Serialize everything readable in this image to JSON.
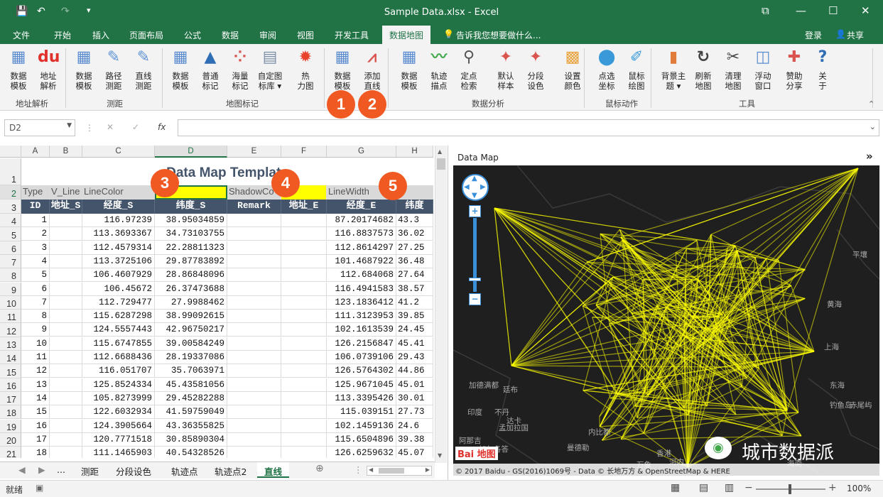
{
  "window": {
    "title": "Sample Data.xlsx - Excel",
    "save_icon": "💾",
    "undo_icon": "↶",
    "redo_icon": "↷",
    "qa_more": "▾",
    "ribbon_display": "⧉",
    "minimize": "—",
    "maximize": "☐",
    "close": "✕"
  },
  "tabs": [
    "文件",
    "开始",
    "插入",
    "页面布局",
    "公式",
    "数据",
    "审阅",
    "视图",
    "开发工具",
    "数据地图"
  ],
  "tell_me": "告诉我您想要做什么...",
  "login": "登录",
  "share": "共享",
  "ribbon": {
    "buttons": [
      {
        "l1": "数据",
        "l2": "模板",
        "icon": "grid-icon",
        "color": "#5a8ccf"
      },
      {
        "l1": "地址",
        "l2": "解析",
        "icon": "du-pin-icon",
        "color": "#e0312b"
      },
      {
        "l1": "数据",
        "l2": "模板",
        "icon": "grid-icon",
        "color": "#5a8ccf"
      },
      {
        "l1": "路径",
        "l2": "测距",
        "icon": "pencil-ruler-icon",
        "color": "#5e93d6"
      },
      {
        "l1": "直线",
        "l2": "测距",
        "icon": "pencil-line-icon",
        "color": "#5e93d6"
      },
      {
        "l1": "数据",
        "l2": "模板",
        "icon": "grid-icon",
        "color": "#5a8ccf"
      },
      {
        "l1": "普通",
        "l2": "标记",
        "icon": "pyramid-icon",
        "color": "#2f6db5"
      },
      {
        "l1": "海量",
        "l2": "标记",
        "icon": "scatter-icon",
        "color": "#d9534f"
      },
      {
        "l1": "自定图",
        "l2": "标库 ▾",
        "icon": "image-library-icon",
        "color": "#7a8fa6"
      },
      {
        "l1": "热",
        "l2": "力图",
        "icon": "heatmap-icon",
        "color": "#e8412c"
      },
      {
        "l1": "数据",
        "l2": "模板",
        "icon": "grid-icon",
        "color": "#5a8ccf"
      },
      {
        "l1": "添加",
        "l2": "直线",
        "icon": "line-chart-icon",
        "color": "#d9534f"
      },
      {
        "l1": "数据",
        "l2": "模板",
        "icon": "grid-icon",
        "color": "#5a8ccf"
      },
      {
        "l1": "轨迹",
        "l2": "描点",
        "icon": "track-icon",
        "color": "#3fa64a"
      },
      {
        "l1": "定点",
        "l2": "检索",
        "icon": "binoculars-icon",
        "color": "#555"
      },
      {
        "l1": "默认",
        "l2": "样本",
        "icon": "china-map-icon",
        "color": "#d9534f"
      },
      {
        "l1": "分段",
        "l2": "设色",
        "icon": "china-map-icon",
        "color": "#d9534f"
      },
      {
        "l1": "设置",
        "l2": "颜色",
        "icon": "palette-icon",
        "color": "#e8a33c"
      },
      {
        "l1": "点选",
        "l2": "坐标",
        "icon": "pin-icon",
        "color": "#3a9ad9"
      },
      {
        "l1": "鼠标",
        "l2": "绘图",
        "icon": "map-draw-icon",
        "color": "#3a9ad9"
      },
      {
        "l1": "背景主",
        "l2": "题 ▾",
        "icon": "bar-chart-icon",
        "color": "#e07b39"
      },
      {
        "l1": "刷新",
        "l2": "地图",
        "icon": "refresh-icon",
        "color": "#444"
      },
      {
        "l1": "清理",
        "l2": "地图",
        "icon": "scissors-icon",
        "color": "#444"
      },
      {
        "l1": "浮动",
        "l2": "窗口",
        "icon": "float-window-icon",
        "color": "#5a8ccf"
      },
      {
        "l1": "赞助",
        "l2": "分享",
        "icon": "gift-icon",
        "color": "#d9534f"
      },
      {
        "l1": "关",
        "l2": "于",
        "icon": "help-icon",
        "color": "#2f6db5"
      }
    ],
    "groups": [
      "地址解析",
      "测距",
      "地图标记",
      "数据分析",
      "鼠标动作",
      "工具"
    ]
  },
  "badges": [
    "1",
    "2",
    "3",
    "4",
    "5"
  ],
  "formula_bar": {
    "namebox": "D2",
    "cancel": "✕",
    "enter": "✓",
    "fx": "fx",
    "value": ""
  },
  "columns": [
    "A",
    "B",
    "C",
    "D",
    "E",
    "F",
    "G",
    "H"
  ],
  "sheet_title": "Data Map Template",
  "row2": {
    "type": "Type",
    "vline": "V_Line",
    "linecolor": "LineColor",
    "shadowcolor": "ShadowCo",
    "linewidth": "LineWidth"
  },
  "headers": [
    "ID",
    "地址_S",
    "经度_S",
    "纬度_S",
    "Remark",
    "地址_E",
    "经度_E",
    "纬度"
  ],
  "rows": [
    [
      "1",
      "",
      "116.97239",
      "38.95034859",
      "",
      "",
      "87.20174682",
      "43.3"
    ],
    [
      "2",
      "",
      "113.3693367",
      "34.73103755",
      "",
      "",
      "116.8837573",
      "36.02"
    ],
    [
      "3",
      "",
      "112.4579314",
      "22.28811323",
      "",
      "",
      "112.8614297",
      "27.25"
    ],
    [
      "4",
      "",
      "113.3725106",
      "29.87783892",
      "",
      "",
      "101.4687922",
      "36.48"
    ],
    [
      "5",
      "",
      "106.4607929",
      "28.86848096",
      "",
      "",
      "112.684068",
      "27.64"
    ],
    [
      "6",
      "",
      "106.45672",
      "26.37473688",
      "",
      "",
      "116.4941583",
      "38.57"
    ],
    [
      "7",
      "",
      "112.729477",
      "27.9988462",
      "",
      "",
      "123.1836412",
      "41.2"
    ],
    [
      "8",
      "",
      "115.6287298",
      "38.99092615",
      "",
      "",
      "111.3123953",
      "39.85"
    ],
    [
      "9",
      "",
      "124.5557443",
      "42.96750217",
      "",
      "",
      "102.1613539",
      "24.45"
    ],
    [
      "10",
      "",
      "115.6747855",
      "39.00584249",
      "",
      "",
      "126.2156847",
      "45.41"
    ],
    [
      "11",
      "",
      "112.6688436",
      "28.19337086",
      "",
      "",
      "106.0739106",
      "29.43"
    ],
    [
      "12",
      "",
      "116.051707",
      "35.7063971",
      "",
      "",
      "126.5764302",
      "44.86"
    ],
    [
      "13",
      "",
      "125.8524334",
      "45.43581056",
      "",
      "",
      "125.9671045",
      "45.01"
    ],
    [
      "14",
      "",
      "105.8273999",
      "29.45282288",
      "",
      "",
      "113.3395426",
      "30.01"
    ],
    [
      "15",
      "",
      "122.6032934",
      "41.59759049",
      "",
      "",
      "115.039151",
      "27.73"
    ],
    [
      "16",
      "",
      "124.3905664",
      "43.36355825",
      "",
      "",
      "102.1459136",
      "24.6"
    ],
    [
      "17",
      "",
      "120.7771518",
      "30.85890304",
      "",
      "",
      "115.6504896",
      "39.38"
    ],
    [
      "18",
      "",
      "111.1465903",
      "40.54328526",
      "",
      "",
      "126.6259632",
      "45.07"
    ]
  ],
  "sheet_tabs": [
    "...",
    "测距",
    "分段设色",
    "轨迹点",
    "轨迹点2",
    "直线"
  ],
  "active_sheet": "直线",
  "status": {
    "ready": "就绪",
    "zoom": "100%"
  },
  "map": {
    "pane_title": "Data Map",
    "collapse": "»",
    "labels": [
      {
        "text": "平壤"
      },
      {
        "text": "黄海"
      },
      {
        "text": "上海"
      },
      {
        "text": "东海"
      },
      {
        "text": "钓鱼岛"
      },
      {
        "text": "赤尾屿"
      },
      {
        "text": "加德满都"
      },
      {
        "text": "廷布"
      },
      {
        "text": "不丹"
      },
      {
        "text": "达卡"
      },
      {
        "text": "加尔各答"
      },
      {
        "text": "孟加拉国"
      },
      {
        "text": "内比都"
      },
      {
        "text": "万象"
      },
      {
        "text": "河内"
      },
      {
        "text": "曼德勒"
      },
      {
        "text": "香港"
      },
      {
        "text": "海南"
      },
      {
        "text": "阿那吉"
      },
      {
        "text": "印度"
      }
    ],
    "logo": "Bai 地图",
    "copyright": "© 2017 Baidu - GS(2016)1069号 - Data © 长地万方 & OpenStreetMap & HERE",
    "watermark": "城市数据派",
    "line_color": "#ffff00"
  }
}
